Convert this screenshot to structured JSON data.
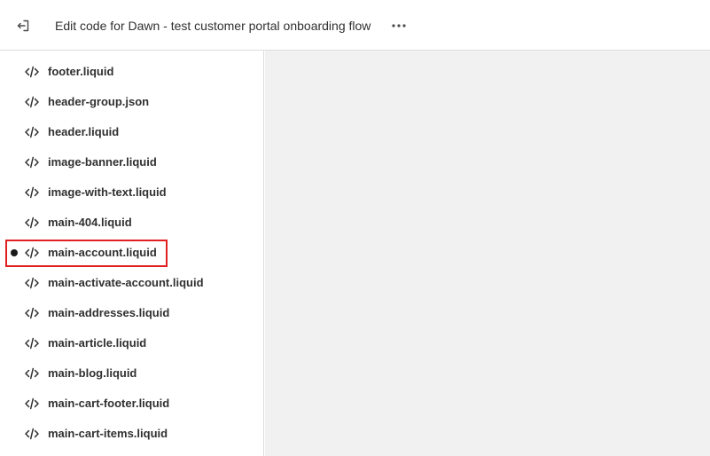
{
  "header": {
    "title": "Edit code for Dawn - test customer portal onboarding flow",
    "exit_icon": "exit-icon",
    "more_icon": "more-horizontal-icon"
  },
  "sidebar": {
    "items": [
      {
        "label": "footer.liquid",
        "icon": "code-icon",
        "active": false
      },
      {
        "label": "header-group.json",
        "icon": "code-icon",
        "active": false
      },
      {
        "label": "header.liquid",
        "icon": "code-icon",
        "active": false
      },
      {
        "label": "image-banner.liquid",
        "icon": "code-icon",
        "active": false
      },
      {
        "label": "image-with-text.liquid",
        "icon": "code-icon",
        "active": false
      },
      {
        "label": "main-404.liquid",
        "icon": "code-icon",
        "active": false
      },
      {
        "label": "main-account.liquid",
        "icon": "code-icon",
        "active": true
      },
      {
        "label": "main-activate-account.liquid",
        "icon": "code-icon",
        "active": false
      },
      {
        "label": "main-addresses.liquid",
        "icon": "code-icon",
        "active": false
      },
      {
        "label": "main-article.liquid",
        "icon": "code-icon",
        "active": false
      },
      {
        "label": "main-blog.liquid",
        "icon": "code-icon",
        "active": false
      },
      {
        "label": "main-cart-footer.liquid",
        "icon": "code-icon",
        "active": false
      },
      {
        "label": "main-cart-items.liquid",
        "icon": "code-icon",
        "active": false
      }
    ]
  },
  "colors": {
    "highlight": "#e02020",
    "editor_bg": "#f1f1f1"
  }
}
